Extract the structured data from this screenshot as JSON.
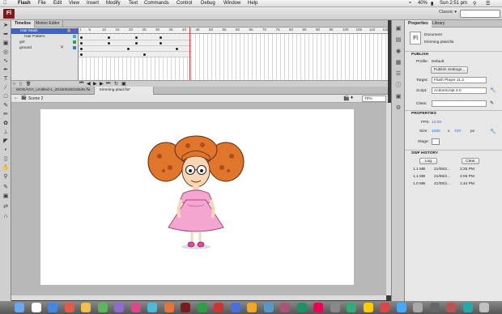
{
  "menubar": {
    "app": "Flash",
    "items": [
      "File",
      "Edit",
      "View",
      "Insert",
      "Modify",
      "Text",
      "Commands",
      "Control",
      "Debug",
      "Window",
      "Help"
    ],
    "battery": "40%",
    "clock": "Sun 2:51 pm"
  },
  "appbar": {
    "badge": "Fl",
    "workspace": "Classic ▾"
  },
  "timeline": {
    "tabs": [
      "Timeline",
      "Motion Editor"
    ],
    "layers": [
      "Hair Mask",
      "Hair Pattern",
      "girl",
      "ground"
    ],
    "ruler": [
      "1",
      "5",
      "10",
      "15",
      "20",
      "25",
      "30",
      "35",
      "40",
      "45",
      "50",
      "55",
      "60",
      "65",
      "70",
      "75",
      "80",
      "85",
      "90",
      "95",
      "100",
      "105",
      "110",
      "115"
    ]
  },
  "doc": {
    "tabs": [
      "MODAVIA_Untitled-1_20150818215535.fla",
      "trimming plaid.fla*"
    ],
    "scene": "Scene 2",
    "zoom": "70%"
  },
  "panel": {
    "tabs": [
      "Properties",
      "Library"
    ],
    "doc_icon": "Fl",
    "doc_type": "Document",
    "doc_name": "trimming plaid.fla",
    "publish_header": "PUBLISH",
    "profile_label": "Profile:",
    "profile_value": "Default",
    "publish_settings": "Publish Settings...",
    "target_label": "Target:",
    "target_value": "Flash Player 11.2",
    "script_label": "Script:",
    "script_value": "ActionScript 3.0",
    "class_label": "Class:",
    "properties_header": "PROPERTIES",
    "fps_label": "FPS:",
    "fps_value": "12.00",
    "size_label": "Size:",
    "size_w": "1280",
    "size_x": "x",
    "size_h": "720",
    "size_unit": "px",
    "stage_label": "Stage:",
    "history_header": "SWF HISTORY",
    "log_btn": "Log",
    "clear_btn": "Clear",
    "history": [
      {
        "size": "1.1 MB",
        "date": "21/06/2...",
        "time": "2:25 PM"
      },
      {
        "size": "1.1 MB",
        "date": "21/06/2...",
        "time": "2:05 PM"
      },
      {
        "size": "1.0 MB",
        "date": "21/06/2...",
        "time": "1:44 PM"
      }
    ]
  },
  "colors": {
    "accent": "#3d64c7",
    "brand": "#7a1c1c",
    "playhead": "#e33333"
  }
}
